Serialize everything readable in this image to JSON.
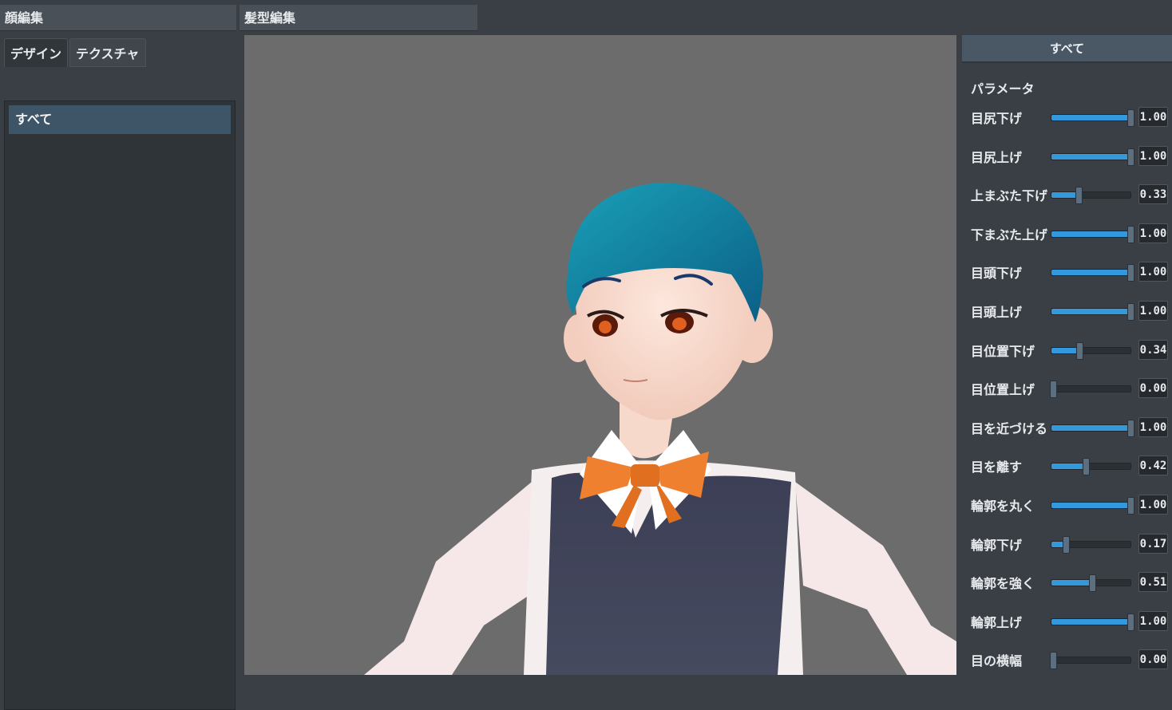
{
  "menu": {
    "tabs": [
      {
        "label": "顔編集"
      },
      {
        "label": "髪型編集"
      }
    ]
  },
  "left_panel": {
    "sub_tabs": [
      {
        "label": "デザイン",
        "active": true
      },
      {
        "label": "テクスチャ",
        "active": false
      }
    ],
    "list": {
      "selected_item": "すべて"
    }
  },
  "viewport": {
    "subject_icon": "avatar-3d-character"
  },
  "right_panel": {
    "header": "すべて",
    "section_title": "パラメータ",
    "params": [
      {
        "label": "目尻下げ",
        "value": "1.00",
        "level": 1.0
      },
      {
        "label": "目尻上げ",
        "value": "1.00",
        "level": 1.0
      },
      {
        "label": "上まぶた下げ",
        "value": "0.33",
        "level": 0.33
      },
      {
        "label": "下まぶた上げ",
        "value": "1.00",
        "level": 1.0
      },
      {
        "label": "目頭下げ",
        "value": "1.00",
        "level": 1.0
      },
      {
        "label": "目頭上げ",
        "value": "1.00",
        "level": 1.0
      },
      {
        "label": "目位置下げ",
        "value": "0.34",
        "level": 0.34
      },
      {
        "label": "目位置上げ",
        "value": "0.00",
        "level": 0.0
      },
      {
        "label": "目を近づける",
        "value": "1.00",
        "level": 1.0
      },
      {
        "label": "目を離す",
        "value": "0.42",
        "level": 0.42
      },
      {
        "label": "輪郭を丸く",
        "value": "1.00",
        "level": 1.0
      },
      {
        "label": "輪郭下げ",
        "value": "0.17",
        "level": 0.17
      },
      {
        "label": "輪郭を強く",
        "value": "0.51",
        "level": 0.51
      },
      {
        "label": "輪郭上げ",
        "value": "1.00",
        "level": 1.0
      },
      {
        "label": "目の横幅",
        "value": "0.00",
        "level": 0.0
      }
    ]
  },
  "colors": {
    "accent": "#3399dd",
    "panel_bg": "#3a3f45",
    "viewport_bg": "#6c6c6c",
    "selection": "#3e5568"
  }
}
